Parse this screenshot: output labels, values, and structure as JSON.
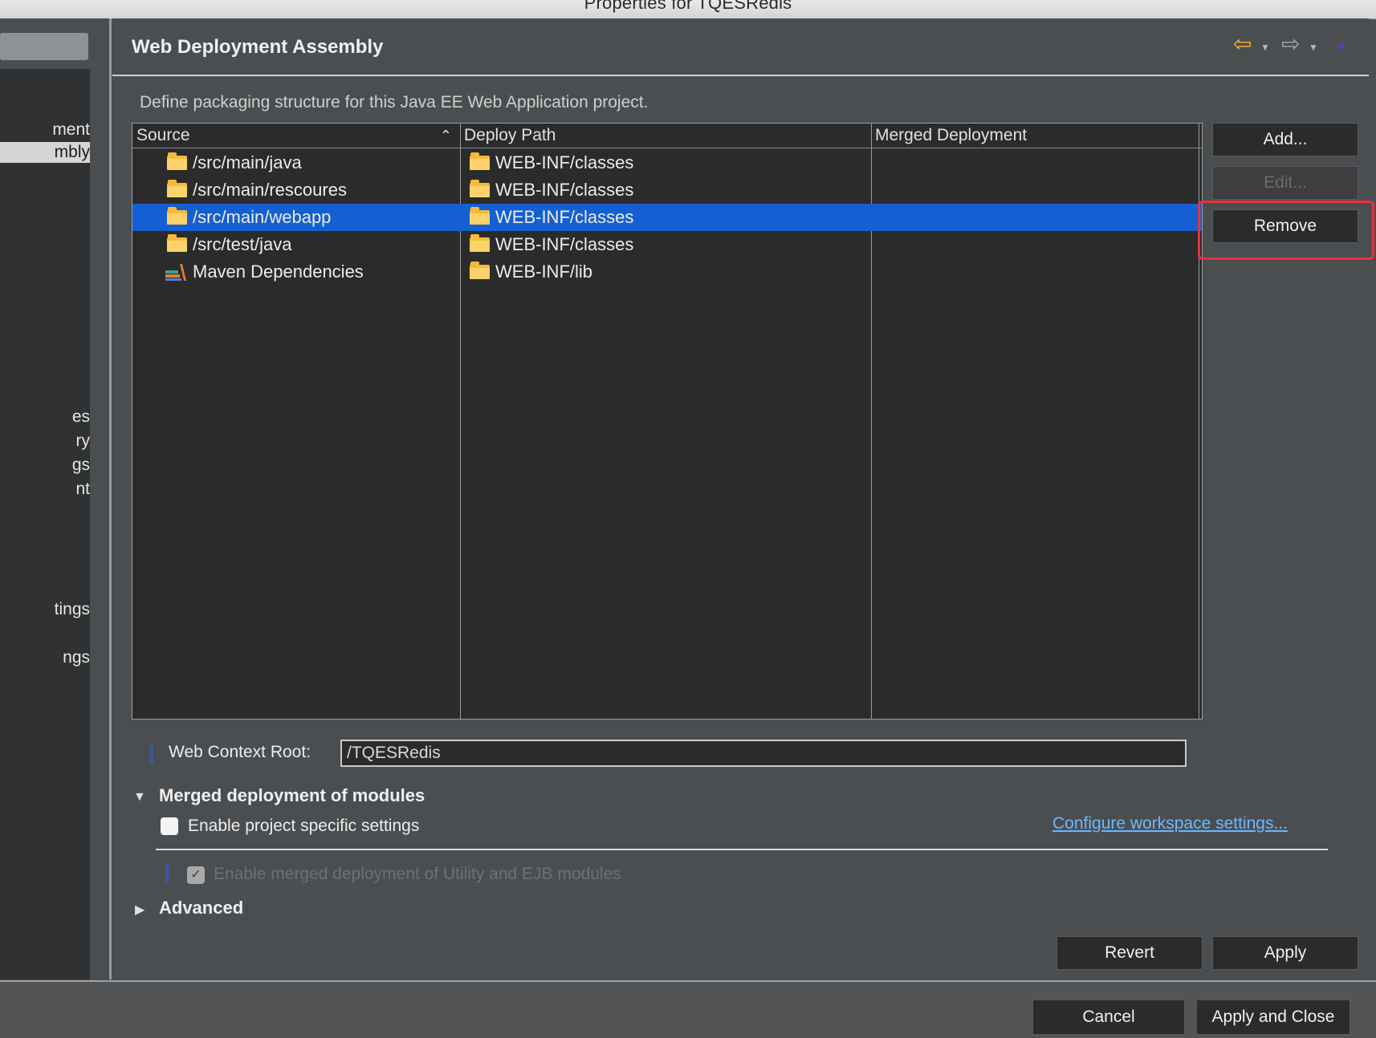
{
  "window": {
    "title": "Properties for TQESRedis"
  },
  "nav": {
    "items": [
      {
        "label": "ment",
        "selected": false
      },
      {
        "label": "mbly",
        "selected": true
      },
      {
        "label": "es",
        "selected": false
      },
      {
        "label": "ry",
        "selected": false
      },
      {
        "label": "gs",
        "selected": false
      },
      {
        "label": "nt",
        "selected": false
      },
      {
        "label": "tings",
        "selected": false
      },
      {
        "label": "ngs",
        "selected": false
      }
    ]
  },
  "page": {
    "title": "Web Deployment Assembly",
    "description": "Define packaging structure for this Java EE Web Application project."
  },
  "table": {
    "columns": [
      "Source",
      "Deploy Path",
      "Merged Deployment"
    ],
    "rows": [
      {
        "source": "/src/main/java",
        "deploy_path": "WEB-INF/classes",
        "merged": "",
        "icon": "folder-icon"
      },
      {
        "source": "/src/main/rescoures",
        "deploy_path": "WEB-INF/classes",
        "merged": "",
        "icon": "folder-icon"
      },
      {
        "source": "/src/main/webapp",
        "deploy_path": "WEB-INF/classes",
        "merged": "",
        "icon": "folder-icon",
        "selected": true
      },
      {
        "source": "/src/test/java",
        "deploy_path": "WEB-INF/classes",
        "merged": "",
        "icon": "folder-icon"
      },
      {
        "source": "Maven Dependencies",
        "deploy_path": "WEB-INF/lib",
        "merged": "",
        "icon": "library-icon"
      }
    ]
  },
  "buttons": {
    "add": "Add...",
    "edit": "Edit...",
    "remove": "Remove",
    "revert": "Revert",
    "apply": "Apply",
    "cancel": "Cancel",
    "apply_close": "Apply and Close"
  },
  "context_root": {
    "label": "Web Context Root:",
    "value": "/TQESRedis"
  },
  "merged_section": {
    "title": "Merged deployment of modules",
    "enable_label": "Enable project specific settings",
    "configure_link": "Configure workspace settings...",
    "merge_label": "Enable merged deployment of Utility and EJB modules"
  },
  "advanced": {
    "title": "Advanced"
  },
  "colors": {
    "selection": "#1460d2",
    "highlight_box": "#e8313f",
    "link": "#6bb7ff"
  }
}
